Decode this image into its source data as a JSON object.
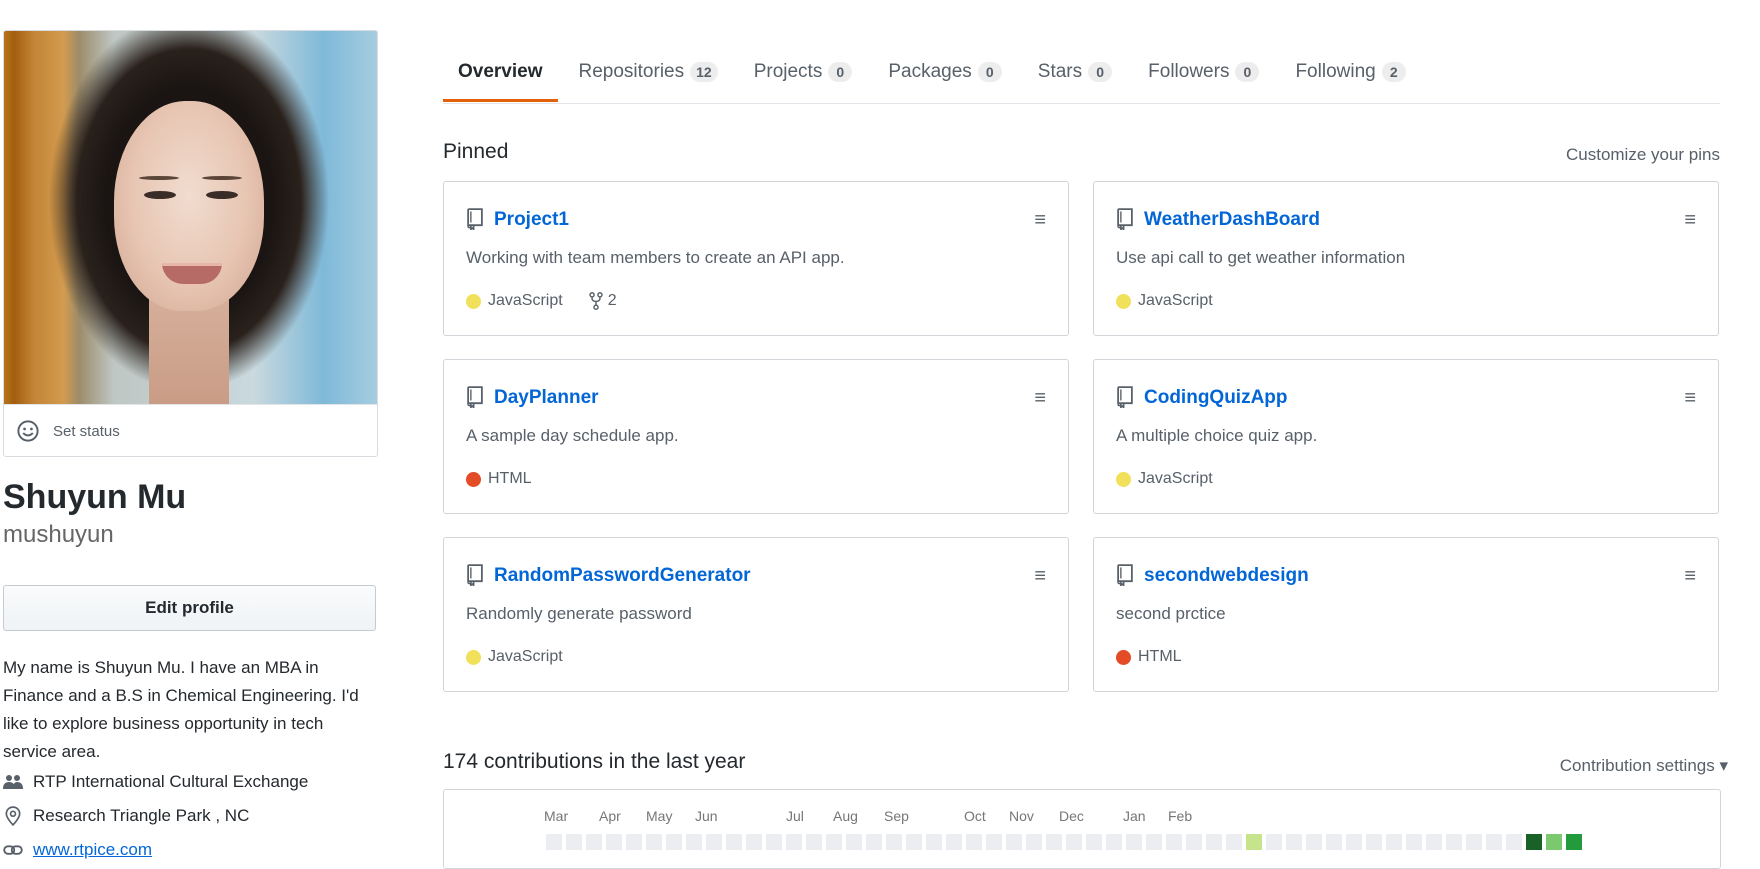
{
  "profile": {
    "set_status": "Set status",
    "fullname": "Shuyun Mu",
    "username": "mushuyun",
    "edit_profile": "Edit profile",
    "bio": "My name is Shuyun Mu. I have an MBA in Finance and a B.S in Chemical Engineering. I'd like to explore business opportunity in tech service area.",
    "organization": "RTP International Cultural Exchange",
    "location": "Research Triangle Park , NC",
    "website": "www.rtpice.com"
  },
  "tabs": [
    {
      "label": "Overview",
      "count": ""
    },
    {
      "label": "Repositories",
      "count": "12"
    },
    {
      "label": "Projects",
      "count": "0"
    },
    {
      "label": "Packages",
      "count": "0"
    },
    {
      "label": "Stars",
      "count": "0"
    },
    {
      "label": "Followers",
      "count": "0"
    },
    {
      "label": "Following",
      "count": "2"
    }
  ],
  "pinned": {
    "title": "Pinned",
    "customize": "Customize your pins",
    "menu_glyph": "≡",
    "repos": [
      {
        "name": "Project1",
        "description": "Working with team members to create an API app.",
        "language": "JavaScript",
        "language_color": "#f1e05a",
        "forks": "2"
      },
      {
        "name": "WeatherDashBoard",
        "description": "Use api call to get weather information",
        "language": "JavaScript",
        "language_color": "#f1e05a",
        "forks": ""
      },
      {
        "name": "DayPlanner",
        "description": "A sample day schedule app.",
        "language": "HTML",
        "language_color": "#e34c26",
        "forks": ""
      },
      {
        "name": "CodingQuizApp",
        "description": "A multiple choice quiz app.",
        "language": "JavaScript",
        "language_color": "#f1e05a",
        "forks": ""
      },
      {
        "name": "RandomPasswordGenerator",
        "description": "Randomly generate password",
        "language": "JavaScript",
        "language_color": "#f1e05a",
        "forks": ""
      },
      {
        "name": "secondwebdesign",
        "description": "second prctice",
        "language": "HTML",
        "language_color": "#e34c26",
        "forks": ""
      }
    ]
  },
  "contributions": {
    "title": "174 contributions in the last year",
    "settings": "Contribution settings ▾",
    "months": [
      "Mar",
      "Apr",
      "May",
      "Jun",
      "Jul",
      "Aug",
      "Sep",
      "Oct",
      "Nov",
      "Dec",
      "Jan",
      "Feb"
    ],
    "colors": {
      "empty": "#ebedf0",
      "level1": "#c6e48b",
      "level2": "#7bc96f",
      "level3": "#239a3b",
      "level4": "#196127"
    }
  }
}
